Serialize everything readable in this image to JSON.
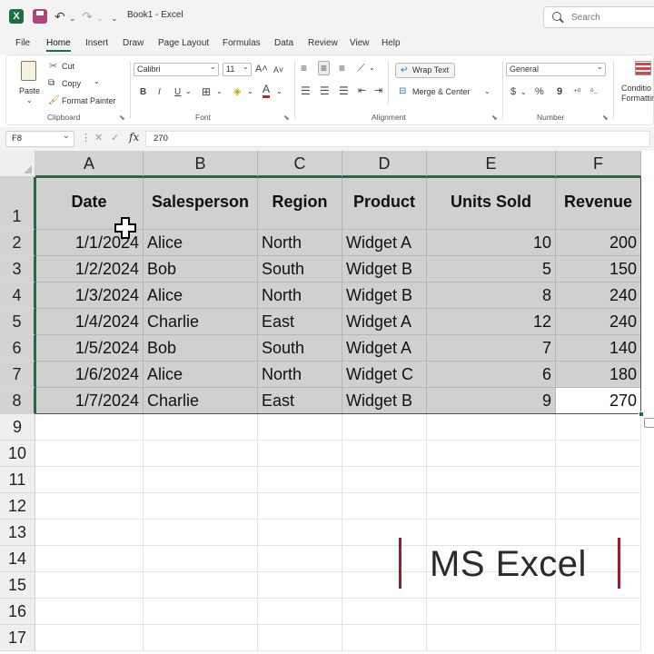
{
  "titlebar": {
    "title": "Book1  -  Excel",
    "search_placeholder": "Search"
  },
  "menu": [
    "File",
    "Home",
    "Insert",
    "Draw",
    "Page Layout",
    "Formulas",
    "Data",
    "Review",
    "View",
    "Help"
  ],
  "ribbon": {
    "clipboard": {
      "paste": "Paste",
      "cut": "Cut",
      "copy": "Copy",
      "format_painter": "Format Painter",
      "label": "Clipboard"
    },
    "font": {
      "name": "Calibri",
      "size": "11",
      "label": "Font",
      "bold": "B",
      "italic": "I",
      "underline": "U"
    },
    "alignment": {
      "wrap_text": "Wrap Text",
      "merge_center": "Merge & Center",
      "label": "Alignment"
    },
    "number": {
      "format": "General",
      "label": "Number",
      "currency": "$",
      "percent": "%",
      "comma": "9"
    },
    "styles": {
      "conditional_line1": "Conditio",
      "conditional_line2": "Formattin"
    }
  },
  "formula_bar": {
    "name_box": "F8",
    "formula": "270",
    "fx": "fx"
  },
  "columns": [
    "A",
    "B",
    "C",
    "D",
    "E",
    "F"
  ],
  "rows": [
    "1",
    "2",
    "3",
    "4",
    "5",
    "6",
    "7",
    "8",
    "9",
    "10",
    "11",
    "12",
    "13",
    "14",
    "15",
    "16",
    "17"
  ],
  "table": {
    "headers": [
      "Date",
      "Salesperson",
      "Region",
      "Product",
      "Units Sold",
      "Revenue"
    ],
    "rows": [
      [
        "1/1/2024",
        "Alice",
        "North",
        "Widget A",
        "10",
        "200"
      ],
      [
        "1/2/2024",
        "Bob",
        "South",
        "Widget B",
        "5",
        "150"
      ],
      [
        "1/3/2024",
        "Alice",
        "North",
        "Widget B",
        "8",
        "240"
      ],
      [
        "1/4/2024",
        "Charlie",
        "East",
        "Widget A",
        "12",
        "240"
      ],
      [
        "1/5/2024",
        "Bob",
        "South",
        "Widget A",
        "7",
        "140"
      ],
      [
        "1/6/2024",
        "Alice",
        "North",
        "Widget C",
        "6",
        "180"
      ],
      [
        "1/7/2024",
        "Charlie",
        "East",
        "Widget B",
        "9",
        "270"
      ]
    ]
  },
  "branding": {
    "text": "MS Excel"
  },
  "colors": {
    "accent": "#1d6f42",
    "selection": "#d0d0d0",
    "brand_bar": "#9b1c2c"
  }
}
